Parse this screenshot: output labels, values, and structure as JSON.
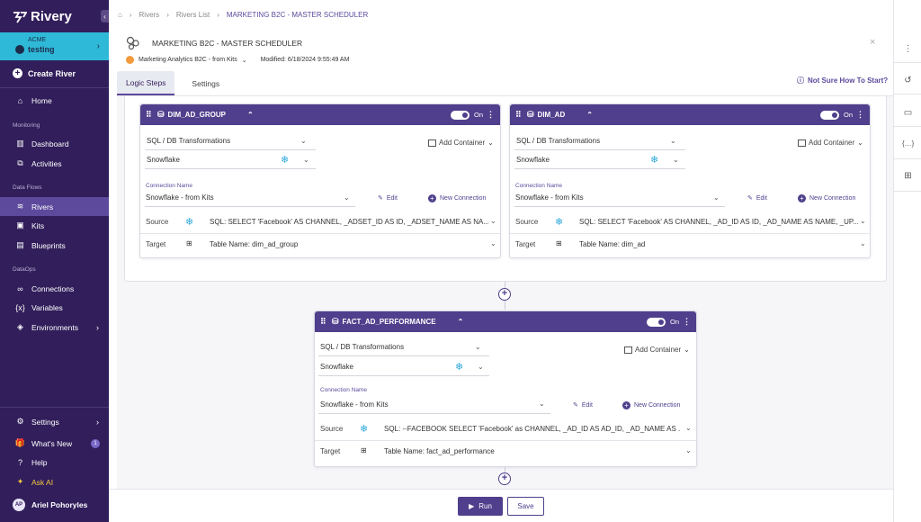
{
  "app": {
    "name": "Rivery"
  },
  "account": {
    "name": "ACME",
    "environment": "testing"
  },
  "sidebar": {
    "create_label": "Create River",
    "home_label": "Home",
    "sections": {
      "monitoring": "Monitoring",
      "data_flows": "Data Flows",
      "dataops": "DataOps"
    },
    "monitoring_items": [
      {
        "label": "Dashboard"
      },
      {
        "label": "Activities"
      }
    ],
    "flow_items": [
      {
        "label": "Rivers"
      },
      {
        "label": "Kits"
      },
      {
        "label": "Blueprints"
      }
    ],
    "ops_items": [
      {
        "label": "Connections"
      },
      {
        "label": "Variables"
      },
      {
        "label": "Environments"
      }
    ],
    "bottom_items": [
      {
        "label": "Settings"
      },
      {
        "label": "What's New",
        "badge": "1"
      },
      {
        "label": "Help"
      },
      {
        "label": "Ask AI"
      }
    ],
    "user": {
      "initials": "AP",
      "name": "Ariel Pohoryles"
    }
  },
  "breadcrumb": {
    "rivers": "Rivers",
    "list": "Rivers List",
    "current": "MARKETING B2C - MASTER SCHEDULER"
  },
  "header": {
    "title": "MARKETING B2C - MASTER SCHEDULER",
    "kit_label": "Marketing Analytics B2C - from Kits",
    "modified": "Modified: 6/18/2024 9:55:49 AM"
  },
  "tabs": [
    {
      "label": "Logic Steps"
    },
    {
      "label": "Settings"
    }
  ],
  "help_link": "Not Sure How To Start?",
  "common": {
    "toggle_on": "On",
    "add_container": "Add Container",
    "connection_name_label": "Connection Name",
    "edit": "Edit",
    "new_connection": "New Connection",
    "source_label": "Source",
    "target_label": "Target"
  },
  "steps": [
    {
      "name": "DIM_AD_GROUP",
      "type": "SQL / DB Transformations",
      "db": "Snowflake",
      "connection": "Snowflake - from Kits",
      "source": "SQL:  SELECT 'Facebook' AS CHANNEL, _ADSET_ID AS ID, _ADSET_NAME AS NA...",
      "target": "Table Name: dim_ad_group"
    },
    {
      "name": "DIM_AD",
      "type": "SQL / DB Transformations",
      "db": "Snowflake",
      "connection": "Snowflake - from Kits",
      "source": "SQL:  SELECT 'Facebook' AS CHANNEL, _AD_ID AS ID, _AD_NAME AS NAME, _UP...",
      "target": "Table Name: dim_ad"
    },
    {
      "name": "FACT_AD_PERFORMANCE",
      "type": "SQL / DB Transformations",
      "db": "Snowflake",
      "connection": "Snowflake - from Kits",
      "source": "SQL:  --FACEBOOK SELECT 'Facebook' as CHANNEL, _AD_ID AS AD_ID, _AD_NAME AS ...",
      "target": "Table Name: fact_ad_performance"
    }
  ],
  "footer": {
    "run": "Run",
    "save": "Save"
  }
}
